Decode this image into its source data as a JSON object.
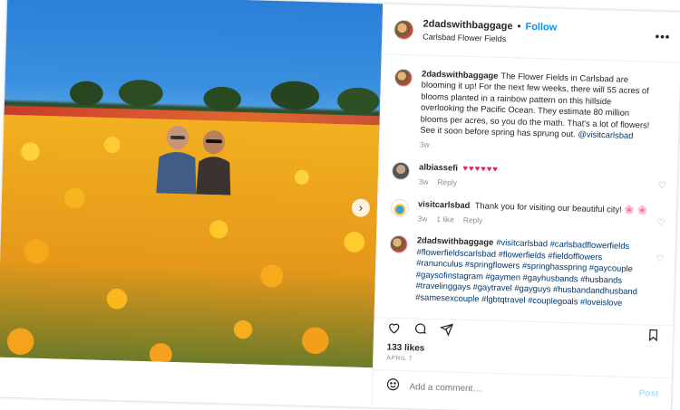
{
  "post": {
    "username": "2dadswithbaggage",
    "follow_label": "Follow",
    "location": "Carlsbad Flower Fields",
    "more_label": "•••",
    "slide_next": "›"
  },
  "comments": [
    {
      "username": "2dadswithbaggage",
      "text": "The Flower Fields in Carlsbad are blooming it up! For the next few weeks, there will 55 acres of blooms planted in a rainbow pattern on this hillside overlooking the Pacific Ocean. They estimate 80 million blooms per acres, so you do the math. That's a lot of flowers! See it soon before spring has sprung out. ",
      "mention": "@visitcarlsbad",
      "time": "3w"
    },
    {
      "username": "albiassefi",
      "text": "♥♥♥♥♥♥",
      "time": "3w",
      "reply": "Reply"
    },
    {
      "username": "visitcarlsbad",
      "text": "Thank you for visiting our beautiful city! 🌸 🌸",
      "time": "3w",
      "likes": "1 like",
      "reply": "Reply"
    },
    {
      "username": "2dadswithbaggage",
      "hashtags": "#visitcarlsbad #carlsbadflowerfields #flowerfieldscarlsbad #flowerfields #fieldofflowers #ranunculus #springflowers #springhasspring #gaycouple #gaysofinstagram #gaymen #gayhusbands #husbands #travelinggays #gaytravel #gayguys #husbandandhusband #samesexcouple #lgbtqtravel #couplegoals #loveislove"
    }
  ],
  "stats": {
    "likes": "133 likes",
    "date": "APRIL 7"
  },
  "add_comment": {
    "placeholder": "Add a comment…",
    "post_label": "Post"
  }
}
